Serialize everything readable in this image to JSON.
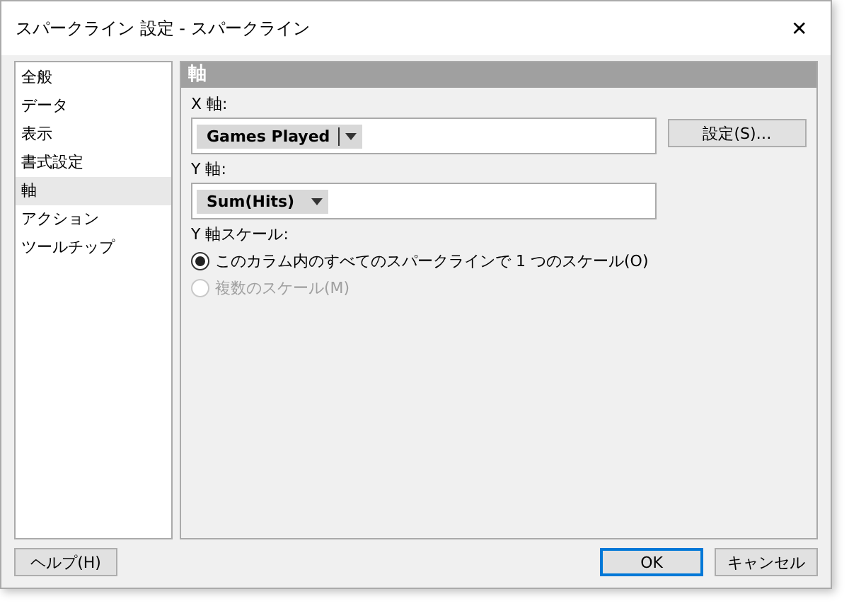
{
  "window": {
    "title": "スパークライン 設定 - スパークライン",
    "close": "✕"
  },
  "sidebar": {
    "items": [
      {
        "label": "全般",
        "selected": false
      },
      {
        "label": "データ",
        "selected": false
      },
      {
        "label": "表示",
        "selected": false
      },
      {
        "label": "書式設定",
        "selected": false
      },
      {
        "label": "軸",
        "selected": true
      },
      {
        "label": "アクション",
        "selected": false
      },
      {
        "label": "ツールチップ",
        "selected": false
      }
    ]
  },
  "panel": {
    "title": "軸",
    "x_axis": {
      "label": "X 軸:",
      "pill": "Games Played",
      "settings_button": "設定(S)…"
    },
    "y_axis": {
      "label": "Y 軸:",
      "pill": "Sum(Hits)"
    },
    "y_scale": {
      "label": "Y 軸スケール:",
      "options": [
        {
          "label": "このカラム内のすべてのスパークラインで 1 つのスケール(O)",
          "selected": true,
          "disabled": false
        },
        {
          "label": "複数のスケール(M)",
          "selected": false,
          "disabled": true
        }
      ]
    }
  },
  "buttons": {
    "help": "ヘルプ(H)",
    "ok": "OK",
    "cancel": "キャンセル"
  }
}
